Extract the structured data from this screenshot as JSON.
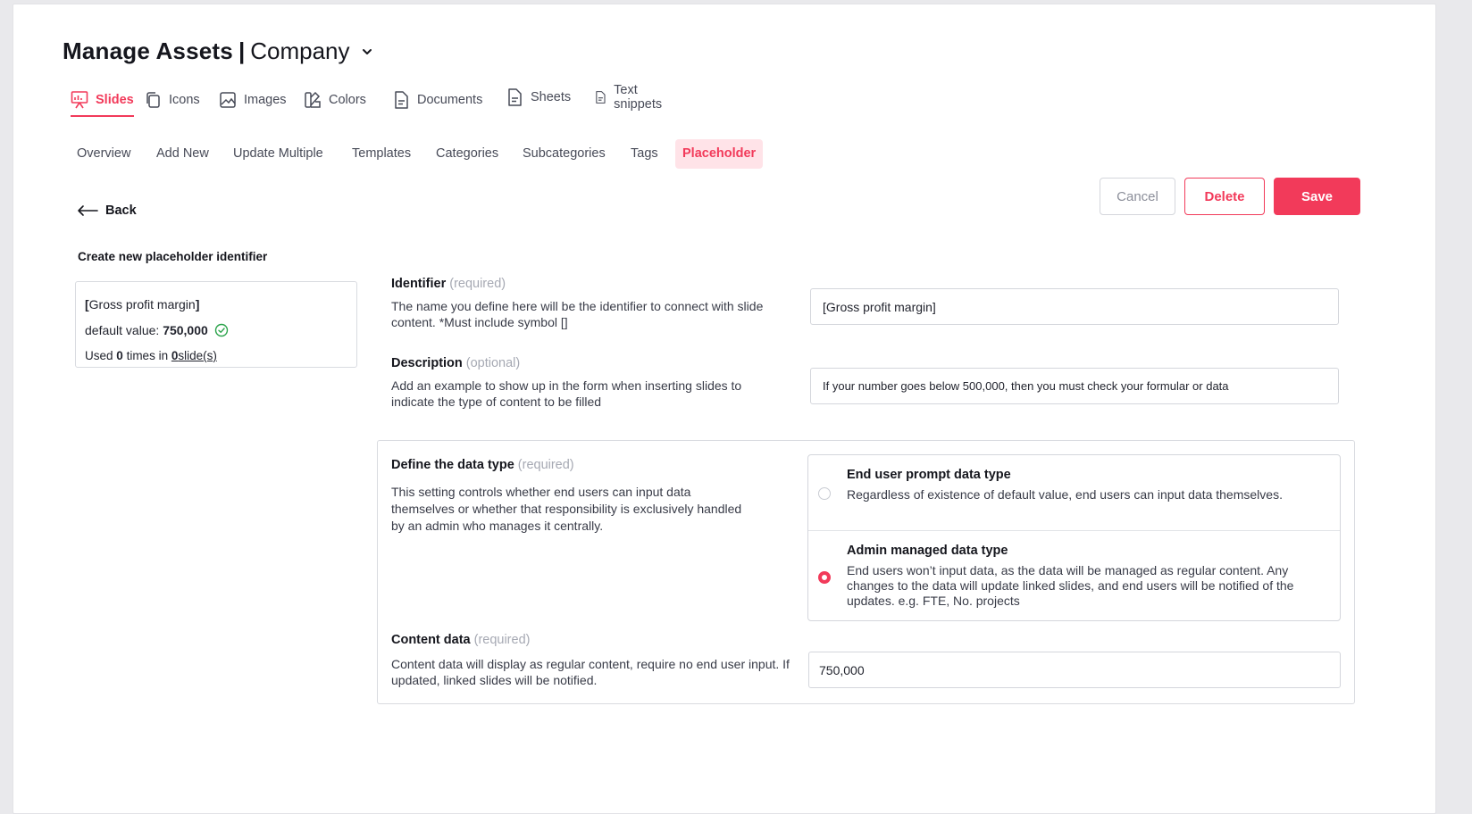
{
  "header": {
    "title": "Manage Assets",
    "separator": "|",
    "company": "Company"
  },
  "asset_tabs": [
    {
      "label": "Slides",
      "icon": "presentation-icon",
      "active": true
    },
    {
      "label": "Icons",
      "icon": "copy-icon",
      "active": false
    },
    {
      "label": "Images",
      "icon": "image-icon",
      "active": false
    },
    {
      "label": "Colors",
      "icon": "color-swatch-icon",
      "active": false
    },
    {
      "label": "Documents",
      "icon": "document-icon",
      "active": false
    },
    {
      "label": "Sheets",
      "icon": "sheet-icon",
      "active": false
    },
    {
      "label": "Text snippets",
      "icon": "text-document-icon",
      "active": false
    }
  ],
  "sub_tabs": [
    {
      "label": "Overview"
    },
    {
      "label": "Add New"
    },
    {
      "label": "Update Multiple"
    },
    {
      "label": "Templates"
    },
    {
      "label": "Categories"
    },
    {
      "label": "Subcategories"
    },
    {
      "label": "Tags"
    },
    {
      "label": "Placeholder",
      "active": true
    }
  ],
  "back_label": "Back",
  "actions": {
    "cancel": "Cancel",
    "delete": "Delete",
    "save": "Save"
  },
  "left_panel": {
    "title": "Create new placeholder identifier",
    "identifier_open": "[",
    "identifier_name": "Gross profit margin",
    "identifier_close": "]",
    "default_label": "default value:",
    "default_value": "750,000",
    "used_prefix": "Used",
    "used_count": "0",
    "used_mid": "times in",
    "slide_count": "0",
    "slide_label": "slide(s)"
  },
  "identifier": {
    "label": "Identifier",
    "required": "(required)",
    "help": "The name you define here will be the identifier to connect with slide content. *Must include symbol []",
    "value": "[Gross profit margin]"
  },
  "description": {
    "label": "Description",
    "optional": "(optional)",
    "help": "Add an example to show up in the form when inserting slides to indicate the type of content to be filled",
    "value": "If your number goes below 500,000, then you must check your formular or data"
  },
  "data_type": {
    "label": "Define the data type",
    "required": "(required)",
    "help": "This setting controls whether end users can input data themselves or whether that responsibility is exclusively handled by an admin who manages it centrally.",
    "options": [
      {
        "title": "End user prompt data type",
        "desc": "Regardless of existence of default value, end users can input data themselves.",
        "selected": false
      },
      {
        "title": "Admin managed data type",
        "desc": "End users won’t input data, as the data will be managed as regular content. Any changes to the data will update linked slides, and end users will be notified of the updates. e.g. FTE, No. projects",
        "selected": true
      }
    ]
  },
  "content_data": {
    "label": "Content data",
    "required": "(required)",
    "help": "Content data will display as regular content, require no end user input. If updated, linked slides will be notified.",
    "value": "750,000"
  },
  "colors": {
    "accent": "#f23a5a",
    "accent_soft": "#ffe3e8",
    "success": "#2aa34a"
  }
}
